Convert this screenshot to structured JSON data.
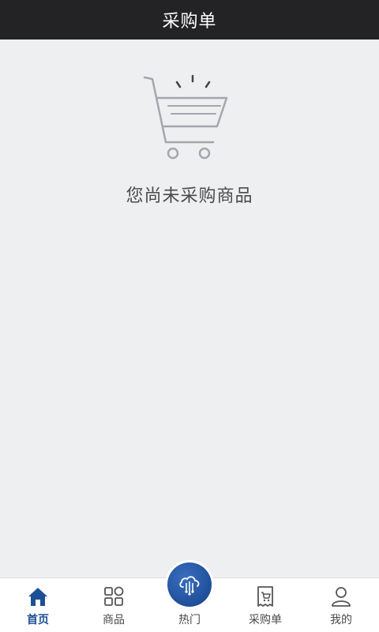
{
  "header": {
    "title": "采购单"
  },
  "empty_state": {
    "message": "您尚未采购商品",
    "illustration": "shopping-cart-icon"
  },
  "tabbar": {
    "active_color": "#1d4f95",
    "tabs": [
      {
        "label": "首页",
        "icon": "home-icon",
        "active": true
      },
      {
        "label": "商品",
        "icon": "grid-icon",
        "active": false
      },
      {
        "label": "热门",
        "icon": "cloud-network-icon",
        "active": false
      },
      {
        "label": "采购单",
        "icon": "purchase-order-icon",
        "active": false
      },
      {
        "label": "我的",
        "icon": "user-icon",
        "active": false
      }
    ]
  }
}
